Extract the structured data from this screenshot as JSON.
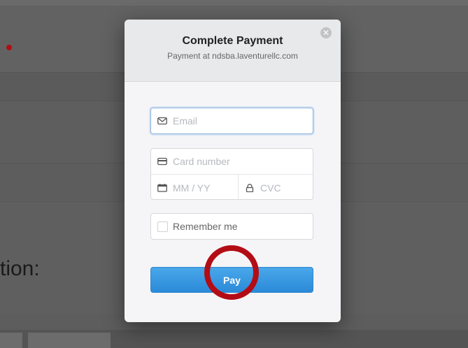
{
  "background": {
    "heading_fragment": "tion:"
  },
  "modal": {
    "title": "Complete Payment",
    "subtitle": "Payment at ndsba.laventurellc.com",
    "close_icon": "close-icon"
  },
  "form": {
    "email": {
      "placeholder": "Email",
      "value": "",
      "icon": "envelope-icon"
    },
    "card_number": {
      "placeholder": "Card number",
      "value": "",
      "icon": "credit-card-icon"
    },
    "expiry": {
      "placeholder": "MM / YY",
      "value": "",
      "icon": "calendar-icon"
    },
    "cvc": {
      "placeholder": "CVC",
      "value": "",
      "icon": "lock-icon"
    },
    "remember_label": "Remember me",
    "remember_checked": false,
    "pay_label": "Pay"
  },
  "colors": {
    "accent": "#2b8ad8",
    "annotation": "#b30c15",
    "backdrop": "#5d5d5d"
  }
}
